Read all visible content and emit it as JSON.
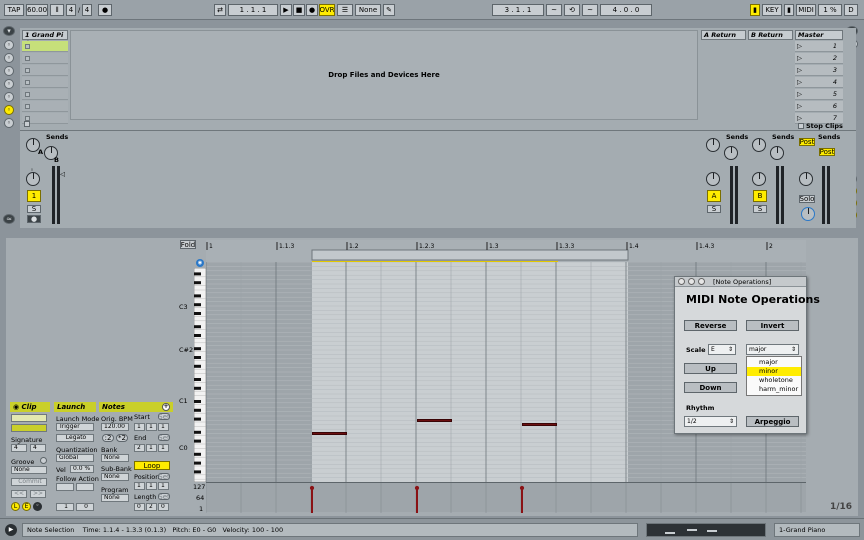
{
  "transport": {
    "tap": "TAP",
    "tempo": "60.00",
    "signature_num": "4",
    "signature_den": "4",
    "quant": "1 Bar",
    "position": "1 . 1 . 1",
    "ovr": "OVR",
    "quant_none": "None",
    "loop_start": "3 . 1 . 1",
    "loop_length": "4 . 0 . 0",
    "key": "KEY",
    "midi": "MIDI",
    "cpu": "1 %",
    "d": "D"
  },
  "session": {
    "track_name": "1 Grand Pi",
    "drop_text": "Drop Files and Devices Here",
    "return_a": "A Return",
    "return_b": "B Return",
    "master": "Master",
    "scenes": [
      "1",
      "2",
      "3",
      "4",
      "5",
      "6",
      "7"
    ],
    "stop_clips": "Stop Clips",
    "sends": "Sends",
    "post": "Post",
    "solo": "Solo",
    "track_number": "1",
    "s": "S",
    "a_label": "A",
    "b_label": "B",
    "knob_a": "A",
    "knob_b": "B"
  },
  "clip": {
    "clip_title": "Clip",
    "launch_title": "Launch",
    "notes_title": "Notes",
    "signature_label": "Signature",
    "sig_num": "4",
    "sig_den": "4",
    "groove_label": "Groove",
    "groove_value": "None",
    "commit": "Commit",
    "launch_mode_label": "Launch Mode",
    "launch_mode": "Trigger",
    "legato": "Legato",
    "quant_label": "Quantization",
    "quant_value": "Global",
    "vel_label": "Vel",
    "vel_value": "0.0 %",
    "follow_label": "Follow Action",
    "follow_a": "1",
    "follow_b": "0",
    "orig_bpm_label": "Orig. BPM",
    "orig_bpm": "120.00",
    "half": ":2",
    "double": "*2",
    "bank_label": "Bank",
    "bank": "None",
    "subbank_label": "Sub-Bank",
    "subbank": "None",
    "program_label": "Program",
    "program": "None",
    "start_label": "Start",
    "start": [
      "1",
      "1",
      "1"
    ],
    "end_label": "End",
    "end": [
      "2",
      "1",
      "1"
    ],
    "loop": "Loop",
    "position_label": "Position",
    "position": [
      "1",
      "1",
      "1"
    ],
    "length_label": "Length",
    "length": [
      "0",
      "2",
      "0"
    ],
    "set": "Set"
  },
  "editor": {
    "fold": "Fold",
    "ruler": [
      "1",
      "1.1.3",
      "1.2",
      "1.2.3",
      "1.3",
      "1.3.3",
      "1.4",
      "1.4.3",
      "2"
    ],
    "keys": [
      "C3",
      "C#2",
      "C1",
      "C0"
    ],
    "vel_scale": [
      "127",
      "64",
      "1"
    ],
    "zoom": "1/16"
  },
  "dialog": {
    "title": "[Note Operations]",
    "heading": "MIDI Note Operations",
    "reverse": "Reverse",
    "invert": "Invert",
    "scale_label": "Scale",
    "scale_key": "E",
    "scale_type": "major",
    "options": [
      "major",
      "minor",
      "wholetone",
      "harm_minor"
    ],
    "up": "Up",
    "down": "Down",
    "rhythm_label": "Rhythm",
    "rhythm": "1/2",
    "arpeggio": "Arpeggio"
  },
  "status": {
    "selection": "Note Selection",
    "time_label": "Time:",
    "time": "1.1.4 - 1.3.3 (0.1.3)",
    "pitch_label": "Pitch:",
    "pitch": "E0 - G0",
    "velocity_label": "Velocity:",
    "velocity": "100 - 100",
    "track": "1-Grand Piano"
  }
}
